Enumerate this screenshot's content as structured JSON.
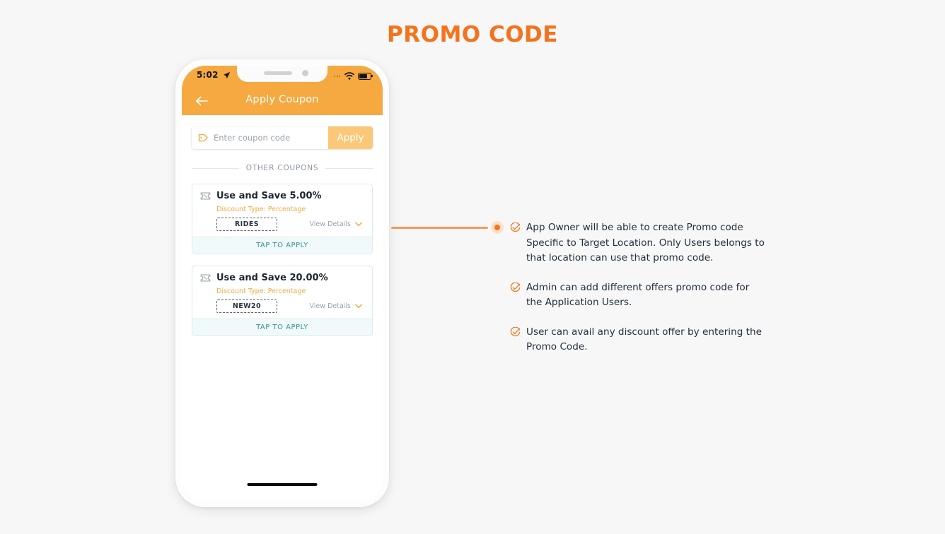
{
  "page": {
    "title": "PROMO CODE",
    "title_color": "#f4731c",
    "background": "#f7f7f7"
  },
  "phone": {
    "status_bar": {
      "time": "5:02",
      "location_icon": "location-arrow-icon",
      "cellular_icon": "cellular-dots-icon",
      "wifi_icon": "wifi-icon",
      "battery_icon": "battery-icon",
      "background": "#f5a940"
    },
    "header": {
      "back_icon": "back-arrow-icon",
      "title": "Apply Coupon",
      "background": "#f5a940"
    },
    "coupon_entry": {
      "tag_icon": "tag-icon",
      "placeholder": "Enter coupon code",
      "value": "",
      "apply_label": "Apply",
      "apply_background": "#fbc779"
    },
    "section_divider": {
      "label": "OTHER COUPONS"
    },
    "coupons": [
      {
        "icon": "ticket-icon",
        "title": "Use and Save 5.00%",
        "discount_type": "Discount Type: Percentage",
        "code": "RIDES",
        "view_details_label": "View Details",
        "chevron_icon": "chevron-down-icon",
        "apply_label": "TAP TO APPLY",
        "apply_color": "#32949b"
      },
      {
        "icon": "ticket-icon",
        "title": "Use and Save 20.00%",
        "discount_type": "Discount Type: Percentage",
        "code": "NEW20",
        "view_details_label": "View Details",
        "chevron_icon": "chevron-down-icon",
        "apply_label": "TAP TO APPLY",
        "apply_color": "#32949b"
      }
    ],
    "home_indicator": "home-indicator"
  },
  "callout": {
    "marker_icon": "connector-dot-marker",
    "line_color": "#f59a5a",
    "bullets": [
      {
        "icon": "check-circle-icon",
        "text": "App Owner will be able to create Promo code Specific to Target Location. Only Users belongs to that location can use that promo code."
      },
      {
        "icon": "check-circle-icon",
        "text": "Admin can add different offers promo code for the Application Users."
      },
      {
        "icon": "check-circle-icon",
        "text": "User can avail any discount offer by entering the Promo Code."
      }
    ]
  }
}
